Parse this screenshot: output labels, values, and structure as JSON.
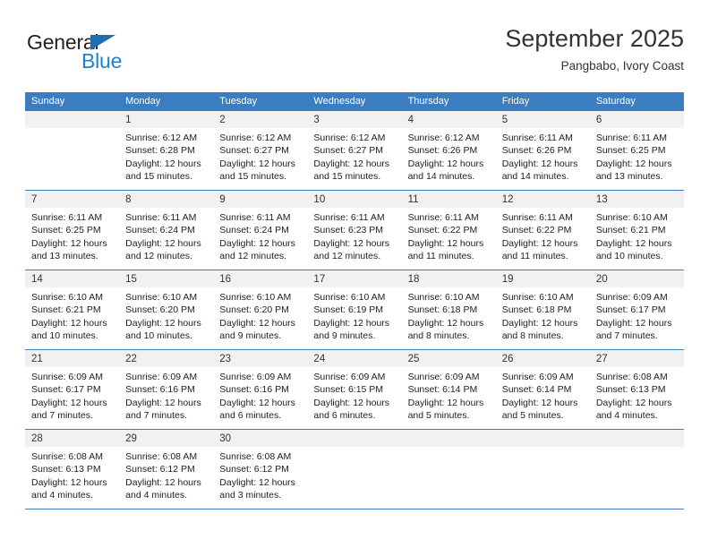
{
  "brand": {
    "name_part1": "General",
    "name_part2": "Blue",
    "triangle_color": "#1f6db5",
    "blue_color": "#1f7fd0"
  },
  "header": {
    "month_title": "September 2025",
    "location": "Pangbabo, Ivory Coast"
  },
  "theme": {
    "header_blue": "#3a7dc0",
    "day_band_gray": "#f1f1f1",
    "cell_white": "#ffffff",
    "text_color": "#222222"
  },
  "weekdays": [
    "Sunday",
    "Monday",
    "Tuesday",
    "Wednesday",
    "Thursday",
    "Friday",
    "Saturday"
  ],
  "weeks": [
    [
      {
        "day": "",
        "sunrise": "",
        "sunset": "",
        "daylight_line1": "",
        "daylight_line2": "",
        "empty": true
      },
      {
        "day": "1",
        "sunrise": "Sunrise: 6:12 AM",
        "sunset": "Sunset: 6:28 PM",
        "daylight_line1": "Daylight: 12 hours",
        "daylight_line2": "and 15 minutes."
      },
      {
        "day": "2",
        "sunrise": "Sunrise: 6:12 AM",
        "sunset": "Sunset: 6:27 PM",
        "daylight_line1": "Daylight: 12 hours",
        "daylight_line2": "and 15 minutes."
      },
      {
        "day": "3",
        "sunrise": "Sunrise: 6:12 AM",
        "sunset": "Sunset: 6:27 PM",
        "daylight_line1": "Daylight: 12 hours",
        "daylight_line2": "and 15 minutes."
      },
      {
        "day": "4",
        "sunrise": "Sunrise: 6:12 AM",
        "sunset": "Sunset: 6:26 PM",
        "daylight_line1": "Daylight: 12 hours",
        "daylight_line2": "and 14 minutes."
      },
      {
        "day": "5",
        "sunrise": "Sunrise: 6:11 AM",
        "sunset": "Sunset: 6:26 PM",
        "daylight_line1": "Daylight: 12 hours",
        "daylight_line2": "and 14 minutes."
      },
      {
        "day": "6",
        "sunrise": "Sunrise: 6:11 AM",
        "sunset": "Sunset: 6:25 PM",
        "daylight_line1": "Daylight: 12 hours",
        "daylight_line2": "and 13 minutes."
      }
    ],
    [
      {
        "day": "7",
        "sunrise": "Sunrise: 6:11 AM",
        "sunset": "Sunset: 6:25 PM",
        "daylight_line1": "Daylight: 12 hours",
        "daylight_line2": "and 13 minutes."
      },
      {
        "day": "8",
        "sunrise": "Sunrise: 6:11 AM",
        "sunset": "Sunset: 6:24 PM",
        "daylight_line1": "Daylight: 12 hours",
        "daylight_line2": "and 12 minutes."
      },
      {
        "day": "9",
        "sunrise": "Sunrise: 6:11 AM",
        "sunset": "Sunset: 6:24 PM",
        "daylight_line1": "Daylight: 12 hours",
        "daylight_line2": "and 12 minutes."
      },
      {
        "day": "10",
        "sunrise": "Sunrise: 6:11 AM",
        "sunset": "Sunset: 6:23 PM",
        "daylight_line1": "Daylight: 12 hours",
        "daylight_line2": "and 12 minutes."
      },
      {
        "day": "11",
        "sunrise": "Sunrise: 6:11 AM",
        "sunset": "Sunset: 6:22 PM",
        "daylight_line1": "Daylight: 12 hours",
        "daylight_line2": "and 11 minutes."
      },
      {
        "day": "12",
        "sunrise": "Sunrise: 6:11 AM",
        "sunset": "Sunset: 6:22 PM",
        "daylight_line1": "Daylight: 12 hours",
        "daylight_line2": "and 11 minutes."
      },
      {
        "day": "13",
        "sunrise": "Sunrise: 6:10 AM",
        "sunset": "Sunset: 6:21 PM",
        "daylight_line1": "Daylight: 12 hours",
        "daylight_line2": "and 10 minutes."
      }
    ],
    [
      {
        "day": "14",
        "sunrise": "Sunrise: 6:10 AM",
        "sunset": "Sunset: 6:21 PM",
        "daylight_line1": "Daylight: 12 hours",
        "daylight_line2": "and 10 minutes."
      },
      {
        "day": "15",
        "sunrise": "Sunrise: 6:10 AM",
        "sunset": "Sunset: 6:20 PM",
        "daylight_line1": "Daylight: 12 hours",
        "daylight_line2": "and 10 minutes."
      },
      {
        "day": "16",
        "sunrise": "Sunrise: 6:10 AM",
        "sunset": "Sunset: 6:20 PM",
        "daylight_line1": "Daylight: 12 hours",
        "daylight_line2": "and 9 minutes."
      },
      {
        "day": "17",
        "sunrise": "Sunrise: 6:10 AM",
        "sunset": "Sunset: 6:19 PM",
        "daylight_line1": "Daylight: 12 hours",
        "daylight_line2": "and 9 minutes."
      },
      {
        "day": "18",
        "sunrise": "Sunrise: 6:10 AM",
        "sunset": "Sunset: 6:18 PM",
        "daylight_line1": "Daylight: 12 hours",
        "daylight_line2": "and 8 minutes."
      },
      {
        "day": "19",
        "sunrise": "Sunrise: 6:10 AM",
        "sunset": "Sunset: 6:18 PM",
        "daylight_line1": "Daylight: 12 hours",
        "daylight_line2": "and 8 minutes."
      },
      {
        "day": "20",
        "sunrise": "Sunrise: 6:09 AM",
        "sunset": "Sunset: 6:17 PM",
        "daylight_line1": "Daylight: 12 hours",
        "daylight_line2": "and 7 minutes."
      }
    ],
    [
      {
        "day": "21",
        "sunrise": "Sunrise: 6:09 AM",
        "sunset": "Sunset: 6:17 PM",
        "daylight_line1": "Daylight: 12 hours",
        "daylight_line2": "and 7 minutes."
      },
      {
        "day": "22",
        "sunrise": "Sunrise: 6:09 AM",
        "sunset": "Sunset: 6:16 PM",
        "daylight_line1": "Daylight: 12 hours",
        "daylight_line2": "and 7 minutes."
      },
      {
        "day": "23",
        "sunrise": "Sunrise: 6:09 AM",
        "sunset": "Sunset: 6:16 PM",
        "daylight_line1": "Daylight: 12 hours",
        "daylight_line2": "and 6 minutes."
      },
      {
        "day": "24",
        "sunrise": "Sunrise: 6:09 AM",
        "sunset": "Sunset: 6:15 PM",
        "daylight_line1": "Daylight: 12 hours",
        "daylight_line2": "and 6 minutes."
      },
      {
        "day": "25",
        "sunrise": "Sunrise: 6:09 AM",
        "sunset": "Sunset: 6:14 PM",
        "daylight_line1": "Daylight: 12 hours",
        "daylight_line2": "and 5 minutes."
      },
      {
        "day": "26",
        "sunrise": "Sunrise: 6:09 AM",
        "sunset": "Sunset: 6:14 PM",
        "daylight_line1": "Daylight: 12 hours",
        "daylight_line2": "and 5 minutes."
      },
      {
        "day": "27",
        "sunrise": "Sunrise: 6:08 AM",
        "sunset": "Sunset: 6:13 PM",
        "daylight_line1": "Daylight: 12 hours",
        "daylight_line2": "and 4 minutes."
      }
    ],
    [
      {
        "day": "28",
        "sunrise": "Sunrise: 6:08 AM",
        "sunset": "Sunset: 6:13 PM",
        "daylight_line1": "Daylight: 12 hours",
        "daylight_line2": "and 4 minutes."
      },
      {
        "day": "29",
        "sunrise": "Sunrise: 6:08 AM",
        "sunset": "Sunset: 6:12 PM",
        "daylight_line1": "Daylight: 12 hours",
        "daylight_line2": "and 4 minutes."
      },
      {
        "day": "30",
        "sunrise": "Sunrise: 6:08 AM",
        "sunset": "Sunset: 6:12 PM",
        "daylight_line1": "Daylight: 12 hours",
        "daylight_line2": "and 3 minutes."
      },
      {
        "day": "",
        "sunrise": "",
        "sunset": "",
        "daylight_line1": "",
        "daylight_line2": "",
        "empty": true
      },
      {
        "day": "",
        "sunrise": "",
        "sunset": "",
        "daylight_line1": "",
        "daylight_line2": "",
        "empty": true
      },
      {
        "day": "",
        "sunrise": "",
        "sunset": "",
        "daylight_line1": "",
        "daylight_line2": "",
        "empty": true
      },
      {
        "day": "",
        "sunrise": "",
        "sunset": "",
        "daylight_line1": "",
        "daylight_line2": "",
        "empty": true
      }
    ]
  ]
}
